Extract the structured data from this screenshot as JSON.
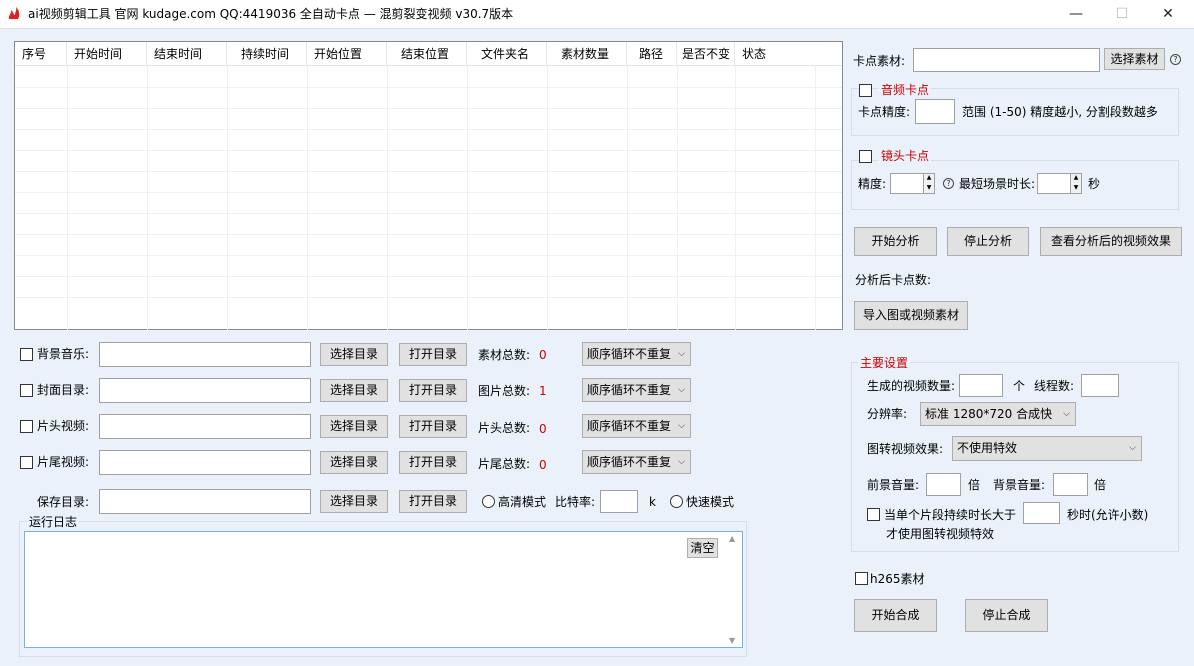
{
  "window": {
    "title": "ai视频剪辑工具 官网 kudage.com QQ:4419036    全自动卡点 — 混剪裂变视频    v30.7版本",
    "minimize": "—",
    "maximize": "☐",
    "close": "✕"
  },
  "table": {
    "columns": [
      "序号",
      "开始时间",
      "结束时间",
      "持续时间",
      "开始位置",
      "结束位置",
      "文件夹名",
      "素材数量",
      "路径",
      "是否不变",
      "状态"
    ]
  },
  "media_rows": [
    {
      "label": "背景音乐:",
      "select_dir": "选择目录",
      "open_dir": "打开目录",
      "count_label": "素材总数:",
      "count": "0",
      "mode": "顺序循环不重复"
    },
    {
      "label": "封面目录:",
      "select_dir": "选择目录",
      "open_dir": "打开目录",
      "count_label": "图片总数:",
      "count": "1",
      "mode": "顺序循环不重复"
    },
    {
      "label": "片头视频:",
      "select_dir": "选择目录",
      "open_dir": "打开目录",
      "count_label": "片头总数:",
      "count": "0",
      "mode": "顺序循环不重复"
    },
    {
      "label": "片尾视频:",
      "select_dir": "选择目录",
      "open_dir": "打开目录",
      "count_label": "片尾总数:",
      "count": "0",
      "mode": "顺序循环不重复"
    }
  ],
  "save": {
    "label": "保存目录:",
    "select_dir": "选择目录",
    "open_dir": "打开目录",
    "hd_mode": "高清模式",
    "bitrate_label": "比特率:",
    "bitrate_unit": "k",
    "fast_mode": "快速模式"
  },
  "log": {
    "title": "运行日志",
    "clear": "清空"
  },
  "right": {
    "material_label": "卡点素材:",
    "select_material": "选择素材",
    "audio_beat": "音频卡点",
    "precision_label": "卡点精度:",
    "range_hint": "范围 (1-50) 精度越小, 分割段数越多",
    "shot_beat": "镜头卡点",
    "shot_precision": "精度:",
    "min_scene": "最短场景时长:",
    "seconds": "秒",
    "start_analysis": "开始分析",
    "stop_analysis": "停止分析",
    "view_effect": "查看分析后的视频效果",
    "beat_count": "分析后卡点数:",
    "import": "导入图或视频素材"
  },
  "settings": {
    "title": "主要设置",
    "gen_count_label": "生成的视频数量:",
    "gen_unit": "个",
    "threads_label": "线程数:",
    "resolution_label": "分辨率:",
    "resolution_value": "标准 1280*720 合成快",
    "img_effect_label": "图转视频效果:",
    "img_effect_value": "不使用特效",
    "fg_volume": "前景音量:",
    "bg_volume": "背景音量:",
    "times": "倍",
    "segment_prefix": "当单个片段持续时长大于",
    "segment_suffix": "秒时(允许小数)",
    "segment_line2": "才使用图转视频特效"
  },
  "bottom": {
    "h265": "h265素材",
    "start_compose": "开始合成",
    "stop_compose": "停止合成"
  },
  "colors": {
    "client_bg": "#eaf1fb",
    "accent_red": "#cc0000",
    "app_icon": "#e02020"
  }
}
